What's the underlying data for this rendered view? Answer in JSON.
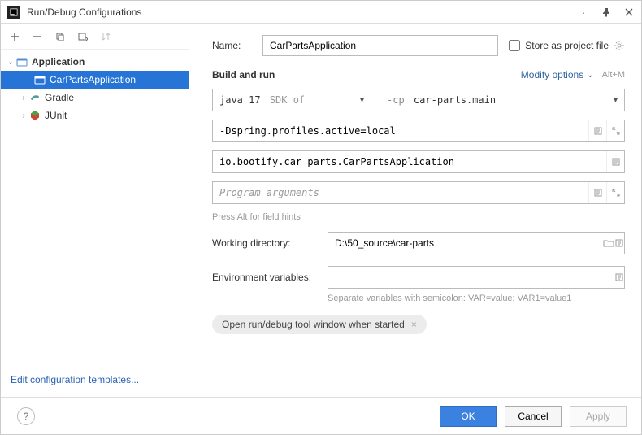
{
  "window": {
    "title": "Run/Debug Configurations"
  },
  "tree": {
    "application": {
      "label": "Application"
    },
    "app_child": {
      "label": "CarPartsApplication"
    },
    "gradle": {
      "label": "Gradle"
    },
    "junit": {
      "label": "JUnit"
    }
  },
  "sidebar": {
    "edit_templates": "Edit configuration templates..."
  },
  "form": {
    "name_label": "Name:",
    "name_value": "CarPartsApplication",
    "store_label": "Store as project file",
    "section": "Build and run",
    "modify": "Modify options",
    "modify_hint": "Alt+M",
    "sdk_value": "java 17",
    "sdk_suffix": "SDK of",
    "cp_prefix": "-cp",
    "cp_value": "car-parts.main",
    "vm_options": "-Dspring.profiles.active=local",
    "main_class": "io.bootify.car_parts.CarPartsApplication",
    "prog_args_placeholder": "Program arguments",
    "field_hints": "Press Alt for field hints",
    "wd_label": "Working directory:",
    "wd_value": "D:\\50_source\\car-parts",
    "env_label": "Environment variables:",
    "env_hint": "Separate variables with semicolon: VAR=value; VAR1=value1",
    "chip": "Open run/debug tool window when started"
  },
  "footer": {
    "ok": "OK",
    "cancel": "Cancel",
    "apply": "Apply"
  }
}
